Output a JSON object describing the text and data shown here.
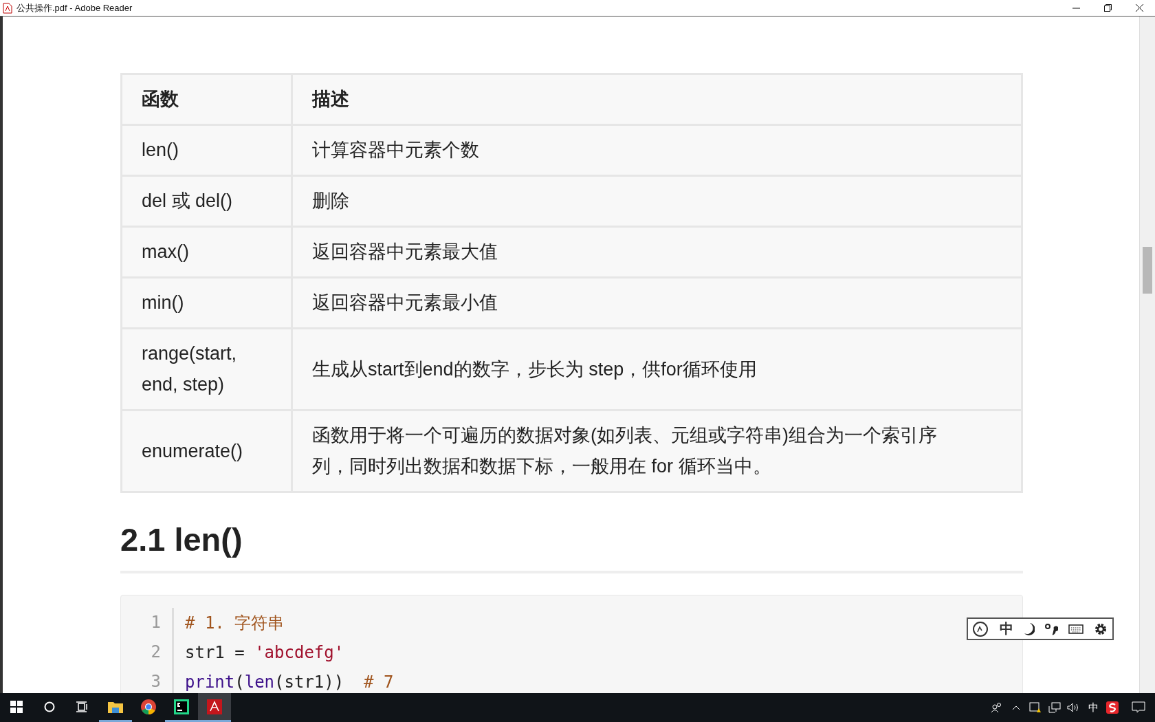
{
  "window": {
    "title": "公共操作.pdf - Adobe Reader"
  },
  "table": {
    "columns": [
      "函数",
      "描述"
    ],
    "rows": [
      {
        "cells": [
          "len()",
          "计算容器中元素个数"
        ]
      },
      {
        "cells": [
          "del 或 del()",
          "删除"
        ]
      },
      {
        "cells": [
          "max()",
          "返回容器中元素最大值"
        ]
      },
      {
        "cells": [
          "min()",
          "返回容器中元素最小值"
        ]
      },
      {
        "cells": [
          "range(start, end, step)",
          "生成从start到end的数字，步长为 step，供for循环使用"
        ]
      },
      {
        "cells": [
          "enumerate()",
          "函数用于将一个可遍历的数据对象(如列表、元组或字符串)组合为一个索引序列，同时列出数据和数据下标，一般用在 for 循环当中。"
        ]
      }
    ]
  },
  "heading": "2.1 len()",
  "code": {
    "lines": [
      {
        "number": "1",
        "tokens": [
          {
            "kind": "comment",
            "text": "# 1. 字符串"
          }
        ]
      },
      {
        "number": "2",
        "tokens": [
          {
            "kind": "plain",
            "text": "str1 = "
          },
          {
            "kind": "string",
            "text": "'abcdefg'"
          }
        ]
      },
      {
        "number": "3",
        "tokens": [
          {
            "kind": "builtin",
            "text": "print"
          },
          {
            "kind": "plain",
            "text": "("
          },
          {
            "kind": "builtin",
            "text": "len"
          },
          {
            "kind": "plain",
            "text": "(str1))  "
          },
          {
            "kind": "comment",
            "text": "# 7"
          }
        ]
      }
    ]
  },
  "ime_toolbar": {
    "mode": "中"
  },
  "taskbar": {
    "apps": [
      {
        "kind": "explorer",
        "selected": false,
        "running": true
      },
      {
        "kind": "chrome",
        "selected": false,
        "running": false
      },
      {
        "kind": "pycharm",
        "selected": false,
        "running": true
      },
      {
        "kind": "acrobat",
        "selected": true,
        "running": true
      }
    ],
    "tray_language": "中"
  }
}
